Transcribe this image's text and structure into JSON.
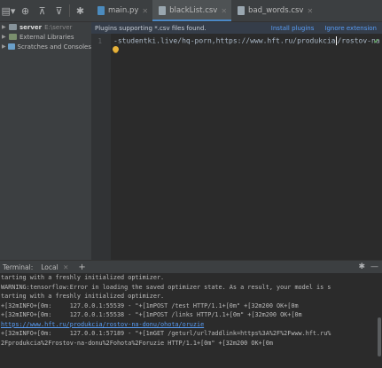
{
  "toolbar": {
    "icons": [
      "project-view-icon",
      "locate-icon",
      "collapse-all-icon",
      "expand-all-icon",
      "settings-gear-icon"
    ]
  },
  "tabs": [
    {
      "label": "main.py",
      "icon": "python-file-icon",
      "color": "#4b8bbe"
    },
    {
      "label": "blackList.csv",
      "icon": "csv-file-icon",
      "color": "#9aa7b0"
    },
    {
      "label": "bad_words.csv",
      "icon": "csv-file-icon",
      "color": "#9aa7b0"
    }
  ],
  "tree": {
    "root_label": "server",
    "root_path": "E:\\server",
    "libraries_label": "External Libraries",
    "scratches_label": "Scratches and Consoles"
  },
  "banner": {
    "message": "Plugins supporting *.csv files found.",
    "install_label": "Install plugins",
    "ignore_label": "Ignore extension"
  },
  "editor": {
    "line_number": "1",
    "code_before_caret": "-studentki.live/hq-porn,https://www.hft.ru/produkcia",
    "code_after_caret": "/rostov-na"
  },
  "terminal": {
    "title": "Terminal:",
    "tab_label": "Local",
    "add_label": "+",
    "lines": [
      {
        "text": "tarting with a freshly initialized optimizer.",
        "link": false
      },
      {
        "text": "WARNING:tensorflow:Error in loading the saved optimizer state. As a result, your model is s",
        "link": false
      },
      {
        "text": "tarting with a freshly initialized optimizer.",
        "link": false
      },
      {
        "text": "+[32mINFO+[0m:     127.0.0.1:55539 - \"+[1mPOST /test HTTP/1.1+[0m\" +[32m200 OK+[0m",
        "link": false
      },
      {
        "text": "+[32mINFO+[0m:     127.0.0.1:55538 - \"+[1mPOST /links HTTP/1.1+[0m\" +[32m200 OK+[0m",
        "link": false
      },
      {
        "text": "https://www.hft.ru/produkcia/rostov-na-donu/ohota/oruzie",
        "link": true
      },
      {
        "text": "+[32mINFO+[0m:     127.0.0.1:57189 - \"+[1mGET /geturl/url?addlink=https%3A%2F%2Fwww.hft.ru%",
        "link": false
      },
      {
        "text": "2Fprodukcia%2Frostov-na-donu%2Fohota%2Foruzie HTTP/1.1+[0m\" +[32m200 OK+[0m",
        "link": false
      }
    ]
  },
  "colors": {
    "accent": "#4a88c7",
    "link": "#589df6",
    "editor_bg": "#2b2b2b",
    "panel_bg": "#3c3f41"
  }
}
